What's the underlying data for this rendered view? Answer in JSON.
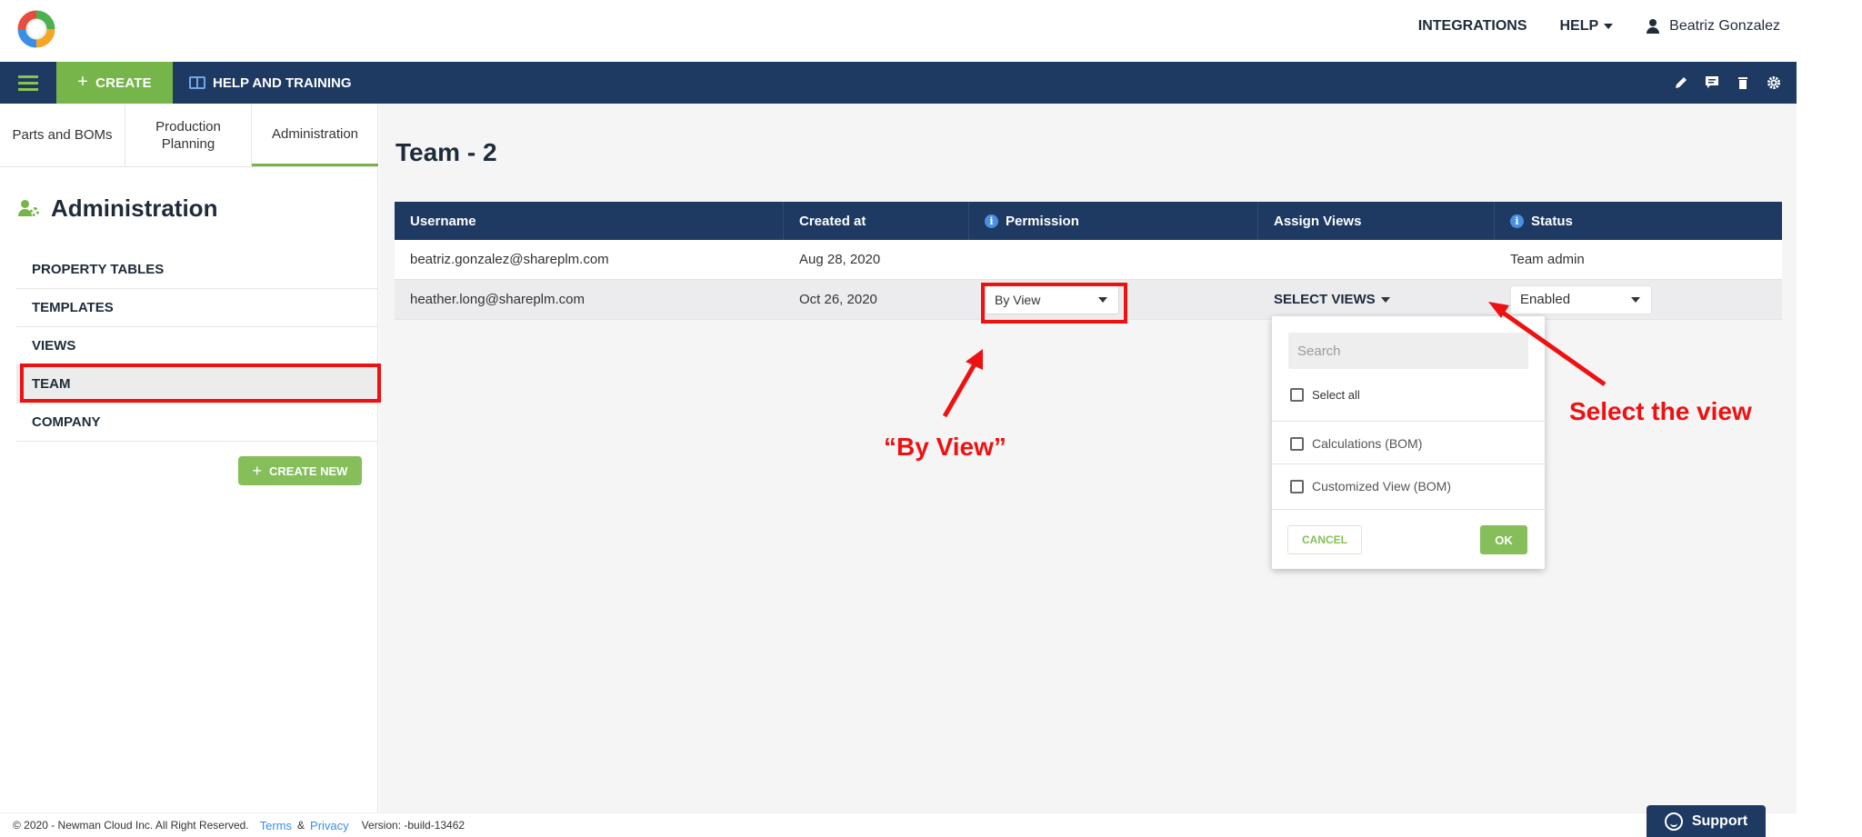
{
  "header": {
    "nav_integrations": "INTEGRATIONS",
    "nav_help": "HELP",
    "user_name": "Beatriz Gonzalez"
  },
  "actionbar": {
    "create_label": "CREATE",
    "help_training_label": "HELP AND TRAINING"
  },
  "left_tabs": [
    {
      "label": "Parts and BOMs"
    },
    {
      "label": "Production Planning"
    },
    {
      "label": "Administration"
    }
  ],
  "sidebar": {
    "title": "Administration",
    "items": [
      {
        "label": "PROPERTY TABLES"
      },
      {
        "label": "TEMPLATES"
      },
      {
        "label": "VIEWS"
      },
      {
        "label": "TEAM"
      },
      {
        "label": "COMPANY"
      }
    ],
    "active_item": "TEAM",
    "create_new_label": "CREATE NEW"
  },
  "main": {
    "page_title": "Team - 2",
    "table": {
      "columns": [
        "Username",
        "Created at",
        "Permission",
        "Assign Views",
        "Status"
      ],
      "rows": [
        {
          "username": "beatriz.gonzalez@shareplm.com",
          "created_at": "Aug 28, 2020",
          "permission": "",
          "assign_views": "",
          "status": "Team admin"
        },
        {
          "username": "heather.long@shareplm.com",
          "created_at": "Oct 26, 2020",
          "permission": "By View",
          "assign_views": "SELECT VIEWS",
          "status": "Enabled"
        }
      ]
    }
  },
  "views_popup": {
    "search_placeholder": "Search",
    "select_all_label": "Select all",
    "options": [
      "Calculations (BOM)",
      "Customized View (BOM)"
    ],
    "cancel_label": "CANCEL",
    "ok_label": "OK"
  },
  "annotations": {
    "by_view_label": "“By View”",
    "select_view_label": "Select the view",
    "color": "#ee1111"
  },
  "footer": {
    "copyright": "© 2020 - Newman Cloud Inc. All Right Reserved.",
    "terms_label": "Terms",
    "amp": "&",
    "privacy_label": "Privacy",
    "version": "Version: -build-13462",
    "support_label": "Support"
  },
  "colors": {
    "navy": "#1e3a63",
    "green": "#76b54a",
    "accent_red": "#ee1111"
  }
}
